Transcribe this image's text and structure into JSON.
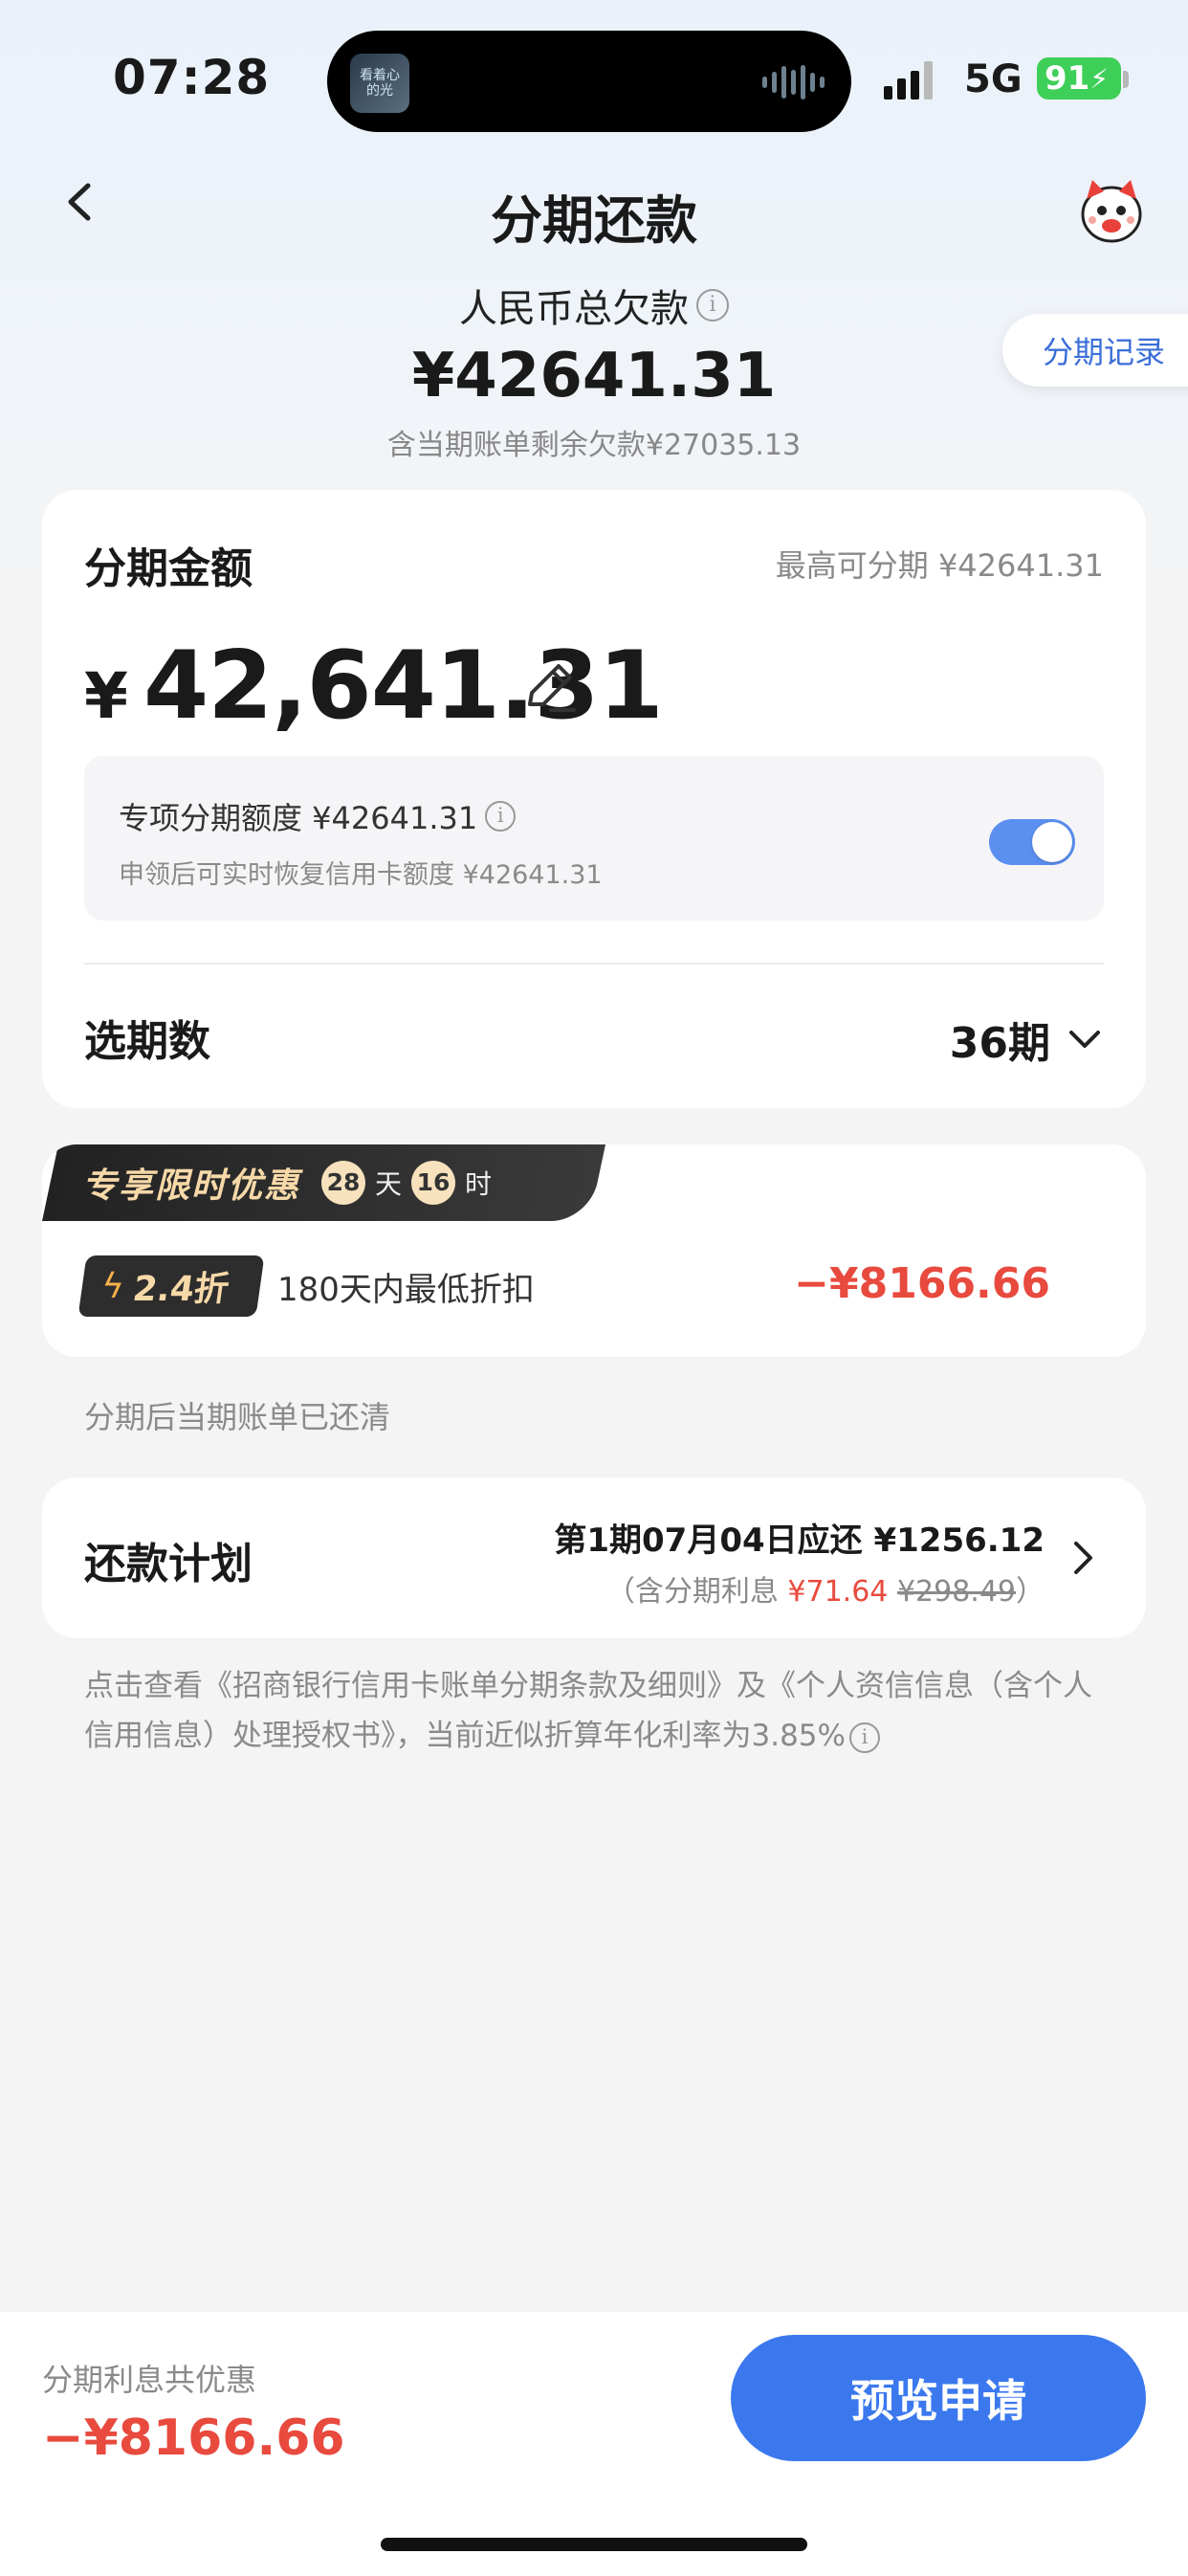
{
  "status": {
    "time": "07:28",
    "island_art_text": "看着心的光",
    "network": "5G",
    "battery": "91"
  },
  "header": {
    "title": "分期还款",
    "record_link": "分期记录"
  },
  "summary": {
    "label": "人民币总欠款",
    "amount": "¥42641.31",
    "sub": "含当期账单剩余欠款¥27035.13"
  },
  "installment": {
    "title": "分期金额",
    "max_label": "最高可分期 ¥42641.31",
    "currency": "¥",
    "amount": "42,641.31",
    "quota_title": "专项分期额度 ¥42641.31",
    "quota_sub": "申领后可实时恢复信用卡额度 ¥42641.31",
    "quota_toggle_on": true,
    "period_label": "选期数",
    "period_value": "36期"
  },
  "promo": {
    "title": "专享限时优惠",
    "days": "28",
    "days_unit": "天",
    "hours": "16",
    "hours_unit": "时",
    "discount": "2.4折",
    "desc": "180天内最低折扣",
    "amount": "−¥8166.66"
  },
  "paid_note": "分期后当期账单已还清",
  "plan": {
    "label": "还款计划",
    "line1": "第1期07月04日应还 ¥1256.12",
    "line2_prefix": "（含分期利息 ",
    "line2_interest": "¥71.64",
    "line2_original": "¥298.49",
    "line2_suffix": "）"
  },
  "terms": "点击查看《招商银行信用卡账单分期条款及细则》及《个人资信信息（含个人信用信息）处理授权书》，当前近似折算年化利率为3.85%",
  "bottom": {
    "saving_label": "分期利息共优惠",
    "saving_amount": "−¥8166.66",
    "apply_button": "预览申请"
  },
  "colors": {
    "accent": "#3b78ee",
    "discount_red": "#e84a3e",
    "toggle_on": "#5b8ff0"
  },
  "icons": [
    "back-icon",
    "mascot-icon",
    "info-icon",
    "edit-icon",
    "chevron-down-icon",
    "bolt-icon",
    "chevron-right-icon"
  ]
}
